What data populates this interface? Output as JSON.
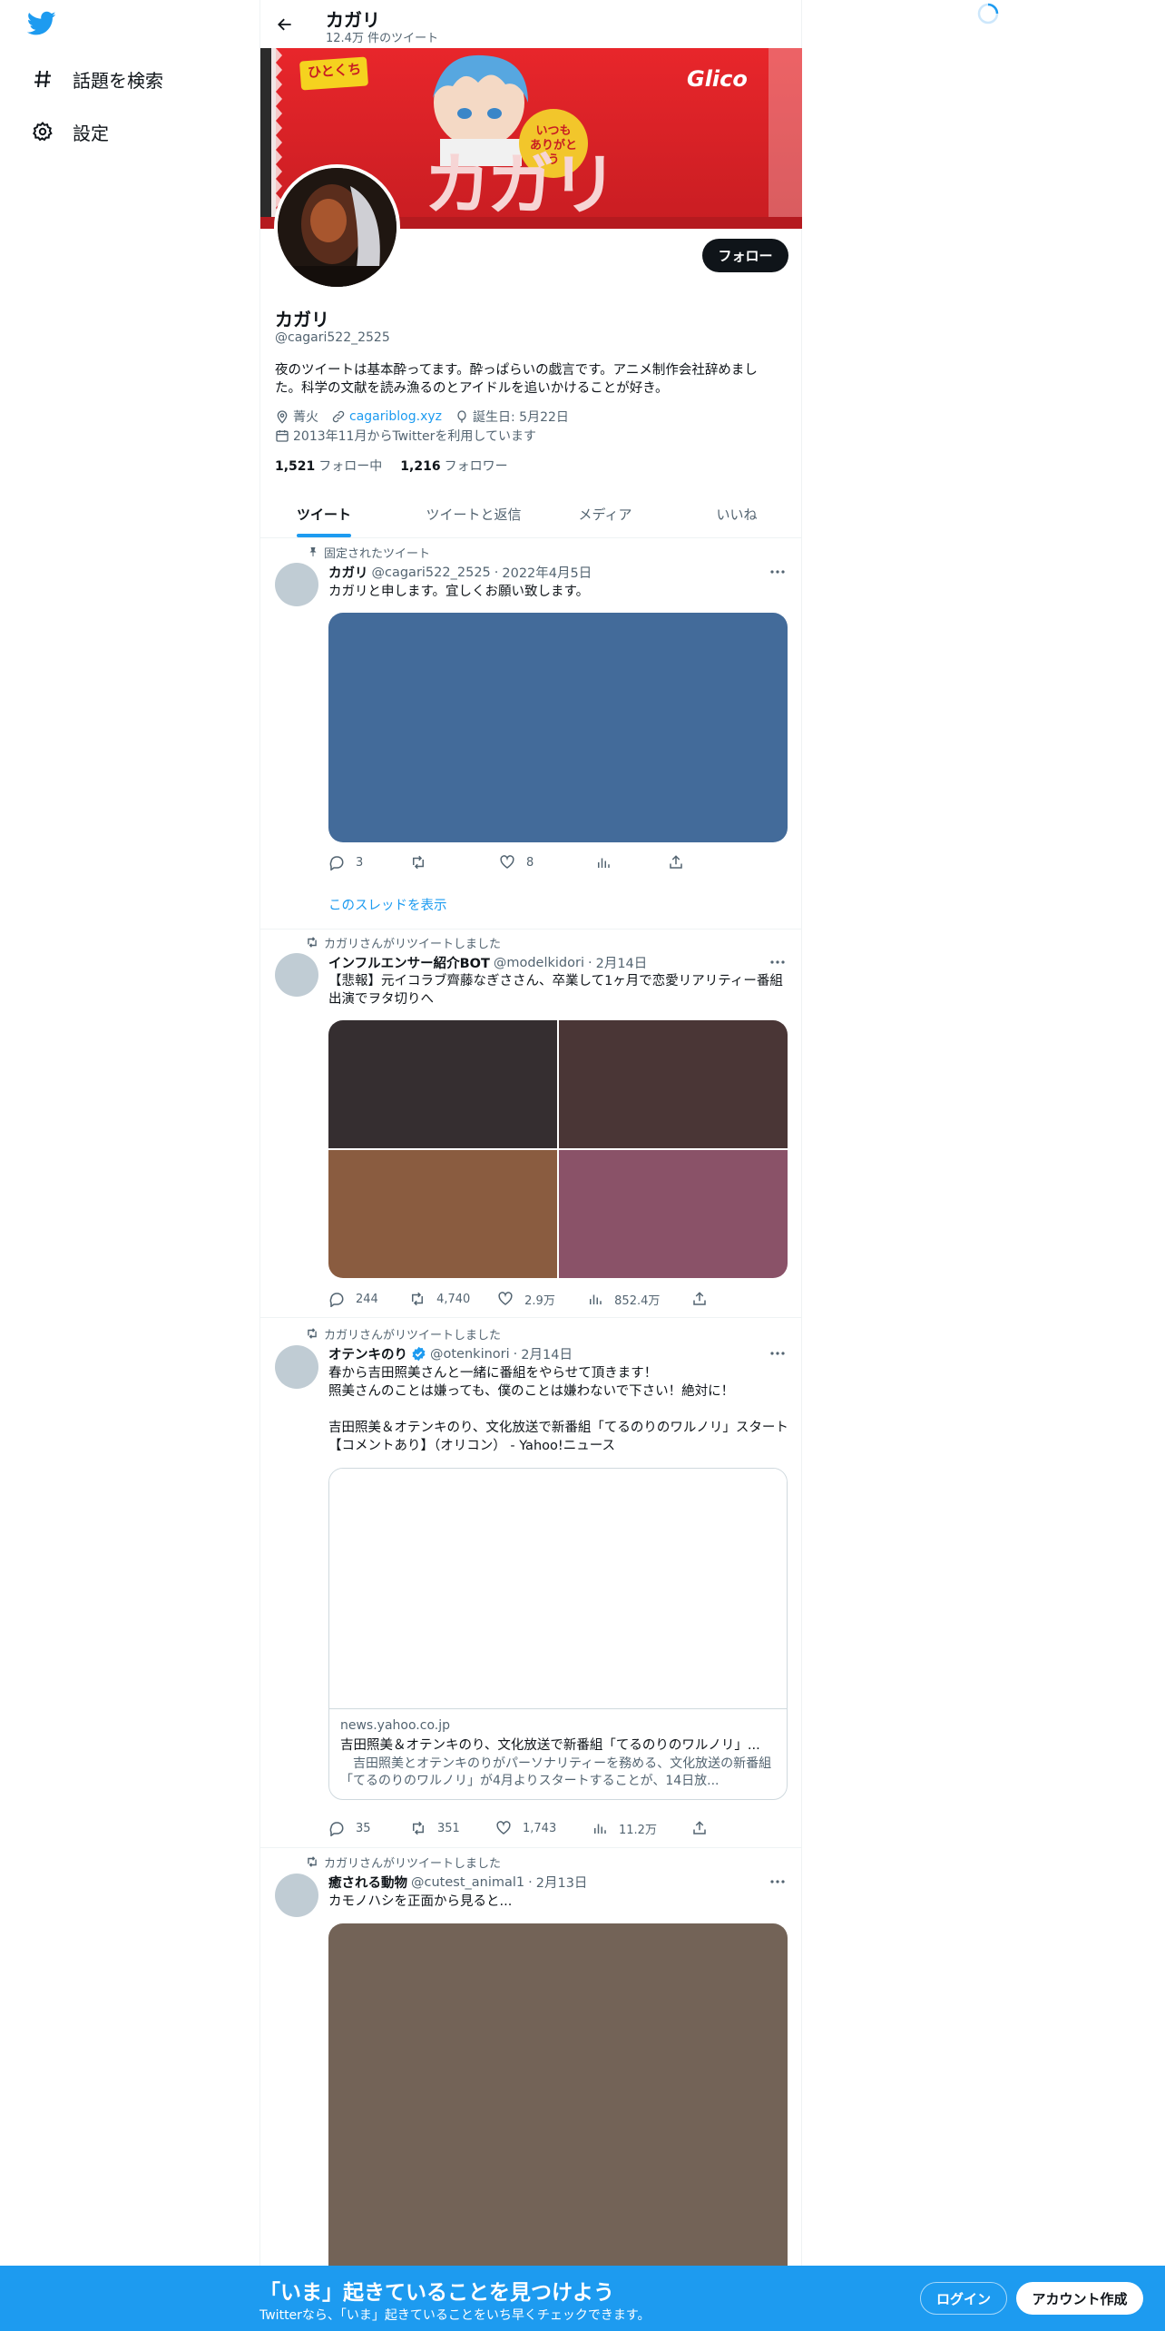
{
  "colors": {
    "accent": "#1d9bf0",
    "text": "#0f1419",
    "muted": "#536471",
    "border": "#eff3f4"
  },
  "nav": {
    "logo_icon": "twitter-bird-icon",
    "items": [
      {
        "label": "話題を検索",
        "icon": "hashtag-icon"
      },
      {
        "label": "設定",
        "icon": "gear-icon"
      }
    ]
  },
  "header": {
    "name": "カガリ",
    "tweet_count": "12.4万 件のツイート"
  },
  "banner": {
    "brand": "Glico",
    "product": "カガリ",
    "badge": "いつも ありがとう",
    "tag": "ひとくち"
  },
  "profile": {
    "follow_label": "フォロー",
    "name": "カガリ",
    "handle": "@cagari522_2525",
    "bio": "夜のツイートは基本酔ってます。酔っぱらいの戯言です。アニメ制作会社辞めました。科学の文献を読み漁るのとアイドルを追いかけることが好き。",
    "location": "菁火",
    "website": "cagariblog.xyz",
    "birthday": "誕生日: 5月22日",
    "joined": "2013年11月からTwitterを利用しています",
    "following_count": "1,521",
    "following_label": "フォロー中",
    "followers_count": "1,216",
    "followers_label": "フォロワー"
  },
  "tabs": [
    {
      "label": "ツイート",
      "active": true
    },
    {
      "label": "ツイートと返信",
      "active": false
    },
    {
      "label": "メディア",
      "active": false
    },
    {
      "label": "いいね",
      "active": false
    }
  ],
  "tweets": [
    {
      "context": "固定されたツイート",
      "name": "カガリ",
      "handle": "@cagari522_2525",
      "date": "2022年4月5日",
      "text": "カガリと申します。宜しくお願い致します。",
      "media_color": "#436b9a",
      "replies": "3",
      "retweets": "",
      "likes": "8",
      "views": "",
      "thread_link": "このスレッドを表示"
    },
    {
      "context": "カガリさんがリツイートしました",
      "name": "インフルエンサー紹介BOT",
      "handle": "@modelkidori",
      "date": "2月14日",
      "text": "【悲報】元イコラブ齊藤なぎささん、卒業して1ヶ月で恋愛リアリティー番組出演でヲタ切りへ",
      "media_colors": [
        "#352e30",
        "#4a3636",
        "#8a5c40",
        "#8a5268"
      ],
      "replies": "244",
      "retweets": "4,740",
      "likes": "2.9万",
      "views": "852.4万"
    },
    {
      "context": "カガリさんがリツイートしました",
      "name": "オテンキのり",
      "handle": "@otenkinori",
      "date": "2月14日",
      "verified": true,
      "text": "春から吉田照美さんと一緒に番組をやらせて頂きます！\n照美さんのことは嫌っても、僕のことは嫌わないで下さい！絶対に！\n\n吉田照美＆オテンキのり、文化放送で新番組「てるのりのワルノリ」スタート【コメントあり】（オリコン） - Yahoo!ニュース",
      "card": {
        "domain": "news.yahoo.co.jp",
        "title": "吉田照美＆オテンキのり、文化放送で新番組「てるのりのワルノリ」...",
        "desc": "　吉田照美とオテンキのりがパーソナリティーを務める、文化放送の新番組「てるのりのワルノリ」が4月よりスタートすることが、14日放..."
      },
      "replies": "35",
      "retweets": "351",
      "likes": "1,743",
      "views": "11.2万"
    },
    {
      "context": "カガリさんがリツイートしました",
      "name": "癒される動物",
      "handle": "@cutest_animal1",
      "date": "2月13日",
      "text": "カモノハシを正面から見ると...",
      "media_color": "#736357"
    }
  ],
  "bottom_bar": {
    "title": "「いま」起きていることを見つけよう",
    "subtitle": "Twitterなら、「いま」起きていることをいち早くチェックできます。",
    "login_label": "ログイン",
    "signup_label": "アカウント作成"
  }
}
